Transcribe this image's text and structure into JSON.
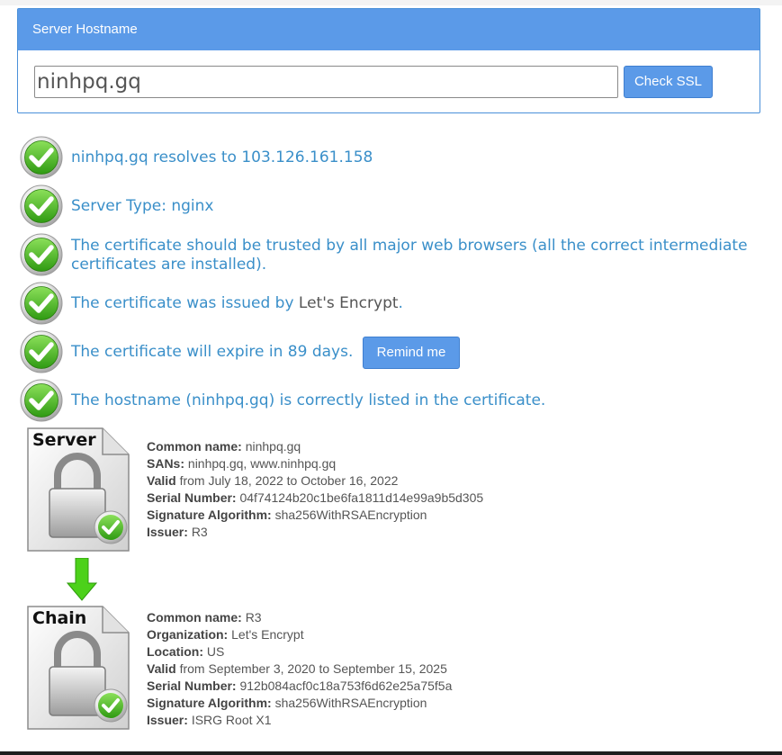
{
  "panel": {
    "title": "Server Hostname",
    "hostname_value": "ninhpq.gq",
    "check_button": "Check SSL"
  },
  "results": {
    "resolves": "ninhpq.gq resolves to 103.126.161.158",
    "server_type": "Server Type: nginx",
    "trusted": "The certificate should be trusted by all major web browsers (all the correct intermediate certificates are installed).",
    "issued_prefix": "The certificate was issued by ",
    "issued_by": "Let's Encrypt",
    "issued_suffix": ".",
    "expire": "The certificate will expire in 89 days.",
    "remind_button": "Remind me",
    "hostname_listed": "The hostname (ninhpq.gq) is correctly listed in the certificate."
  },
  "server_cert": {
    "icon_label": "Server",
    "common_name_label": "Common name:",
    "common_name": "ninhpq.gq",
    "sans_label": "SANs:",
    "sans": "ninhpq.gq, www.ninhpq.gq",
    "valid_label": "Valid",
    "valid": "from July 18, 2022 to October 16, 2022",
    "serial_label": "Serial Number:",
    "serial": "04f74124b20c1be6fa1811d14e99a9b5d305",
    "sig_label": "Signature Algorithm:",
    "sig": "sha256WithRSAEncryption",
    "issuer_label": "Issuer:",
    "issuer": "R3"
  },
  "chain_cert": {
    "icon_label": "Chain",
    "common_name_label": "Common name:",
    "common_name": "R3",
    "org_label": "Organization:",
    "org": "Let's Encrypt",
    "location_label": "Location:",
    "location": "US",
    "valid_label": "Valid",
    "valid": "from September 3, 2020 to September 15, 2025",
    "serial_label": "Serial Number:",
    "serial": "912b084acf0c18a753f6d62e25a75f5a",
    "sig_label": "Signature Algorithm:",
    "sig": "sha256WithRSAEncryption",
    "issuer_label": "Issuer:",
    "issuer": "ISRG Root X1"
  },
  "colors": {
    "accent": "#5b9ae8",
    "result_text": "#3a8fc9",
    "check_green": "#4caf1e"
  }
}
